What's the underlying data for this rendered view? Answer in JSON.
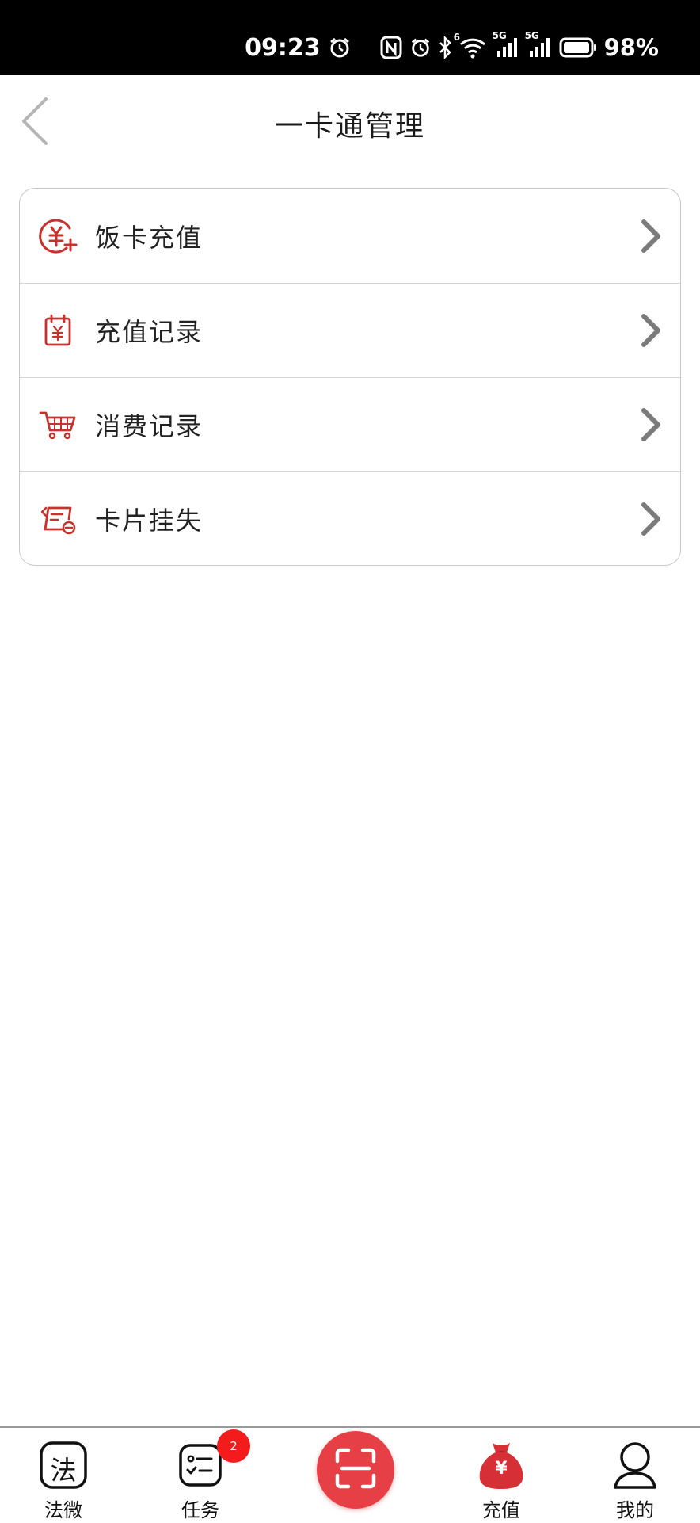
{
  "status_bar": {
    "time": "09:23",
    "battery": "98%",
    "net1": "5G",
    "net2": "5G",
    "wifi_sup": "6"
  },
  "header": {
    "title": "一卡通管理"
  },
  "menu": {
    "items": [
      {
        "label": "饭卡充值",
        "icon": "yuan-plus-icon"
      },
      {
        "label": "充值记录",
        "icon": "calendar-yuan-icon"
      },
      {
        "label": "消费记录",
        "icon": "shopping-cart-icon"
      },
      {
        "label": "卡片挂失",
        "icon": "card-report-loss-icon"
      }
    ]
  },
  "tab_bar": {
    "tabs": [
      {
        "label": "法微",
        "icon": "fawei-icon"
      },
      {
        "label": "任务",
        "icon": "task-list-icon",
        "badge": "2"
      },
      {
        "label": "",
        "icon": "scan-icon"
      },
      {
        "label": "充值",
        "icon": "money-bag-icon"
      },
      {
        "label": "我的",
        "icon": "person-icon"
      }
    ],
    "fawei_glyph": "法",
    "recharge_glyph": "¥"
  },
  "colors": {
    "accent_red": "#c8322d",
    "scan_red": "#e64046",
    "chevron_gray": "#7b7b7b",
    "badge_red": "#f31b1b"
  }
}
